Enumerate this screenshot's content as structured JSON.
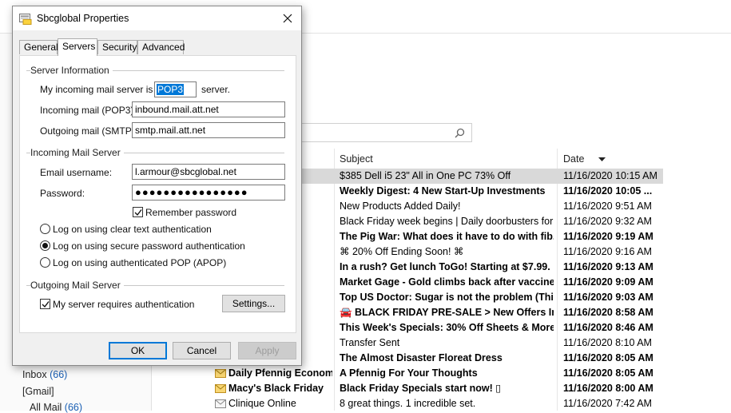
{
  "dialog": {
    "title": "Sbcglobal Properties",
    "tabs": [
      "General",
      "Servers",
      "Security",
      "Advanced"
    ],
    "server_info": {
      "section_title": "Server Information",
      "incoming_type_prefix": "My incoming mail server is a",
      "incoming_type_value": "POP3",
      "incoming_type_suffix": "server.",
      "incoming_label": "Incoming mail (POP3):",
      "incoming_value": "inbound.mail.att.net",
      "outgoing_label": "Outgoing mail (SMTP):",
      "outgoing_value": "smtp.mail.att.net"
    },
    "incoming_server": {
      "section_title": "Incoming Mail Server",
      "username_label": "Email username:",
      "username_value": "l.armour@sbcglobal.net",
      "password_label": "Password:",
      "password_value": "●●●●●●●●●●●●●●●●",
      "remember_label": "Remember password",
      "remember_checked": true,
      "radio_clear": "Log on using clear text authentication",
      "radio_spa": "Log on using secure password authentication",
      "radio_apop": "Log on using authenticated POP (APOP)",
      "selected_radio": "spa"
    },
    "outgoing_server": {
      "section_title": "Outgoing Mail Server",
      "auth_label": "My server requires authentication",
      "auth_checked": true,
      "settings_button": "Settings..."
    },
    "buttons": {
      "ok": "OK",
      "cancel": "Cancel",
      "apply": "Apply"
    }
  },
  "mail_list": {
    "columns": {
      "subject": "Subject",
      "date": "Date"
    },
    "rows": [
      {
        "from": "ics",
        "subject": "$385 Dell i5 23\" All in One PC 73% Off",
        "date": "11/16/2020 10:15 AM",
        "bold": false,
        "selected": true,
        "icon": ""
      },
      {
        "from": "",
        "subject": "Weekly Digest: 4 New Start-Up Investments",
        "date": "11/16/2020 10:05 ...",
        "bold": true,
        "selected": false,
        "icon": ""
      },
      {
        "from": "",
        "subject": "New Products Added Daily!",
        "date": "11/16/2020 9:51 AM",
        "bold": false,
        "selected": false,
        "icon": ""
      },
      {
        "from": "",
        "subject": "Black Friday week begins | Daily doorbusters for all",
        "date": "11/16/2020 9:32 AM",
        "bold": false,
        "selected": false,
        "icon": ""
      },
      {
        "from": "ting",
        "subject": "The Pig War: What does it have to do with fib...",
        "date": "11/16/2020 9:19 AM",
        "bold": true,
        "selected": false,
        "icon": ""
      },
      {
        "from": "",
        "subject": "⌘ 20% Off Ending Soon! ⌘",
        "date": "11/16/2020 9:16 AM",
        "bold": false,
        "selected": false,
        "icon": ""
      },
      {
        "from": "",
        "subject": "In a rush? Get lunch ToGo! Starting at $7.99.",
        "date": "11/16/2020 9:13 AM",
        "bold": true,
        "selected": false,
        "icon": ""
      },
      {
        "from": "",
        "subject": "Market Gage - Gold climbs back after vaccine ...",
        "date": "11/16/2020 9:09 AM",
        "bold": true,
        "selected": false,
        "icon": ""
      },
      {
        "from": "",
        "subject": "Top US Doctor: Sugar is not the problem (This ...",
        "date": "11/16/2020 9:03 AM",
        "bold": true,
        "selected": false,
        "icon": ""
      },
      {
        "from": "",
        "subject": "🚘 BLACK FRIDAY PRE-SALE > New Offers Insi...",
        "date": "11/16/2020 8:58 AM",
        "bold": true,
        "selected": false,
        "icon": ""
      },
      {
        "from": "ore",
        "subject": "This Week's Specials: 30% Off Sheets & More!",
        "date": "11/16/2020 8:46 AM",
        "bold": true,
        "selected": false,
        "icon": ""
      },
      {
        "from": "ment",
        "subject": "Transfer Sent",
        "date": "11/16/2020 8:10 AM",
        "bold": false,
        "selected": false,
        "icon": ""
      },
      {
        "from": "log",
        "subject": "The Almost Disaster Floreat Dress",
        "date": "11/16/2020 8:05 AM",
        "bold": true,
        "selected": false,
        "icon": ""
      },
      {
        "from": "Daily Pfennig Econom...",
        "subject": "A Pfennig For Your Thoughts",
        "date": "11/16/2020 8:05 AM",
        "bold": true,
        "selected": false,
        "icon": "closed"
      },
      {
        "from": "Macy's Black Friday",
        "subject": "Black Friday Specials start now! ▯",
        "date": "11/16/2020 8:00 AM",
        "bold": true,
        "selected": false,
        "icon": "closed"
      },
      {
        "from": "Clinique Online",
        "subject": "8 great things. 1 incredible set.",
        "date": "11/16/2020 7:42 AM",
        "bold": false,
        "selected": false,
        "icon": "open"
      }
    ]
  },
  "folders": {
    "inbox_label": "Inbox",
    "inbox_count": "(66)",
    "gmail_label": "[Gmail]",
    "allmail_label": "All Mail",
    "allmail_count": "(66)"
  },
  "colors": {
    "accent": "#0078d7",
    "selected_row": "#d9d9d9",
    "link_count": "#1a5fb4"
  }
}
